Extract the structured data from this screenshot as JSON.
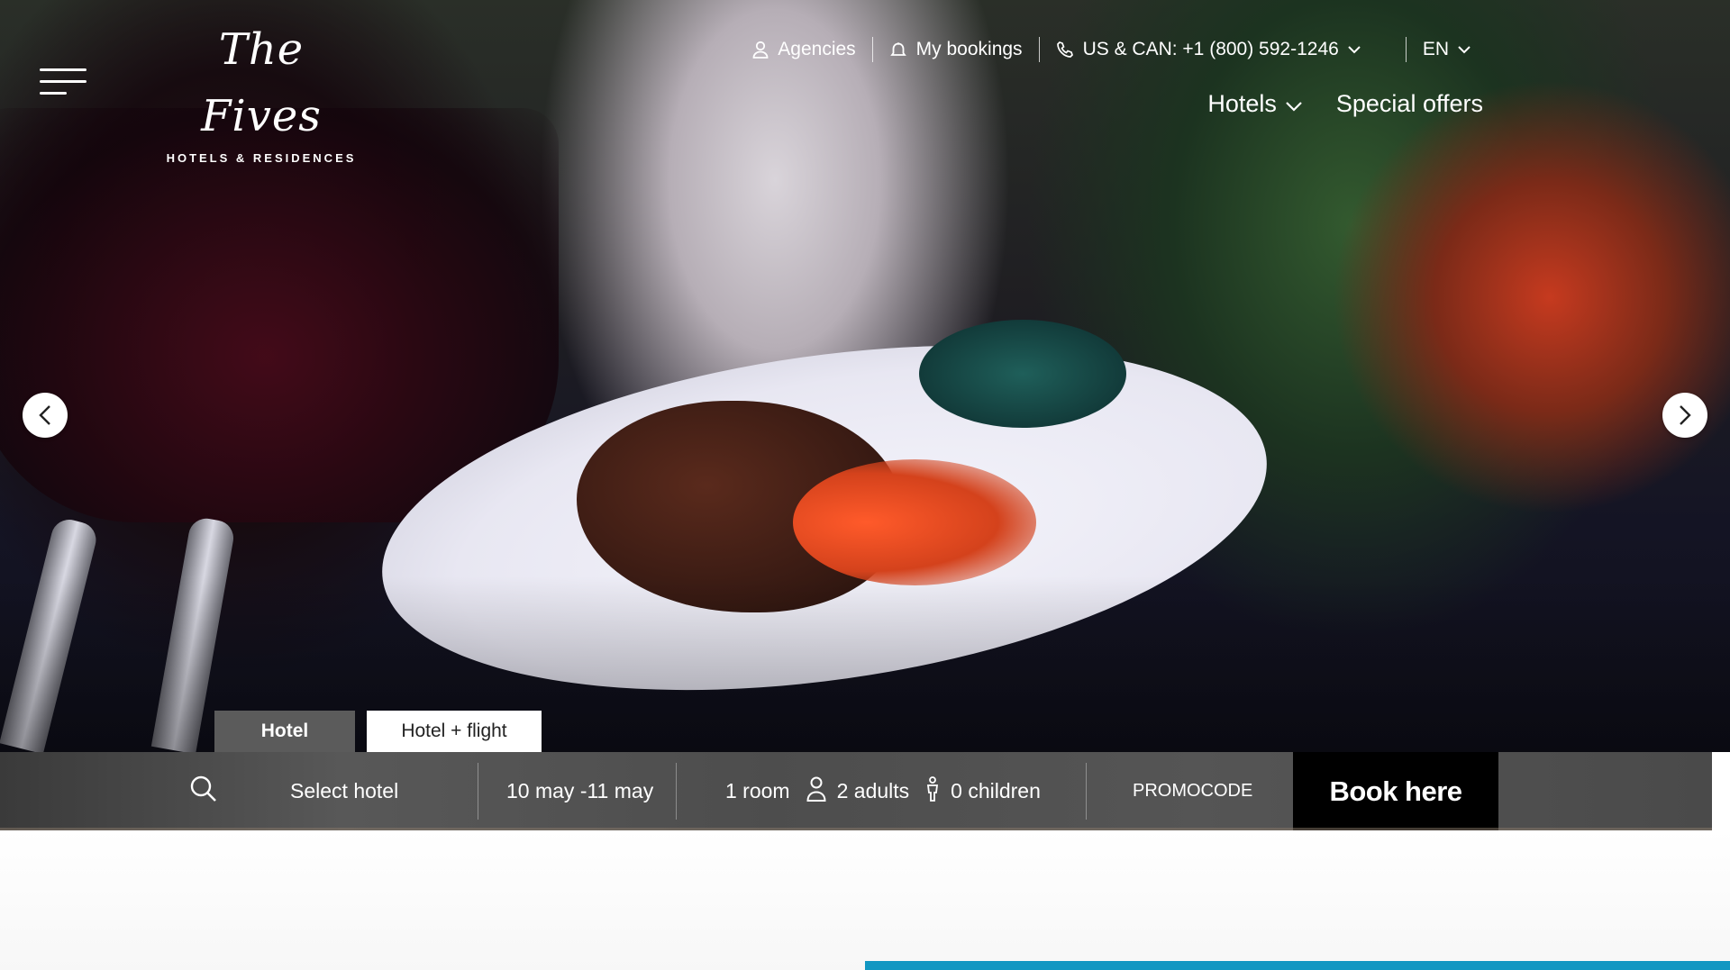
{
  "brand": {
    "logo_script": "The Fives",
    "logo_subtitle": "HOTELS & RESIDENCES"
  },
  "topbar": {
    "agencies": "Agencies",
    "my_bookings": "My bookings",
    "phone": "US & CAN: +1 (800) 592-1246",
    "language": "EN"
  },
  "nav": {
    "hotels": "Hotels",
    "special_offers": "Special offers"
  },
  "booking": {
    "tabs": [
      "Hotel",
      "Hotel + flight"
    ],
    "active_tab": "Hotel",
    "select_hotel": "Select hotel",
    "dates": "10 may -11 may",
    "rooms": "1 room",
    "adults": "2 adults",
    "children": "0 children",
    "promocode": "PROMOCODE",
    "book_button": "Book here"
  },
  "icons": {
    "menu": "hamburger-menu-icon",
    "agencies": "user-icon",
    "bookings": "bell-icon",
    "phone": "phone-icon",
    "search": "search-icon",
    "adults": "person-icon",
    "children": "child-icon",
    "prev": "chevron-left-icon",
    "next": "chevron-right-icon"
  },
  "colors": {
    "book_button_bg": "#000000",
    "booking_bar_bg": "#4f4f4f",
    "active_tab_bg": "#5b5b5b",
    "accent_strip": "#1297c2"
  }
}
